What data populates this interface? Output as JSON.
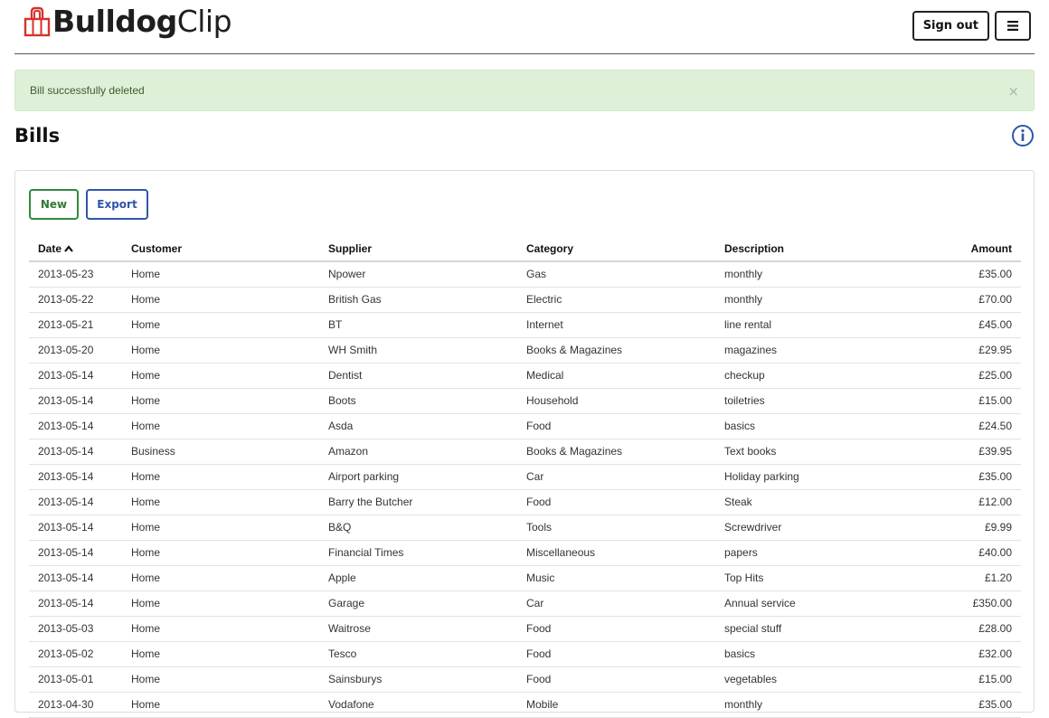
{
  "brand": {
    "bold": "Bulldog",
    "light": "Clip"
  },
  "header": {
    "sign_out_label": "Sign out"
  },
  "alert": {
    "message": "Bill successfully deleted",
    "close_label": "×"
  },
  "page": {
    "title": "Bills"
  },
  "toolbar": {
    "new_label": "New",
    "export_label": "Export"
  },
  "table": {
    "sort_column": "Date",
    "headers": {
      "date": "Date",
      "customer": "Customer",
      "supplier": "Supplier",
      "category": "Category",
      "description": "Description",
      "amount": "Amount"
    },
    "rows": [
      {
        "date": "2013-05-23",
        "customer": "Home",
        "supplier": "Npower",
        "category": "Gas",
        "description": "monthly",
        "amount": "£35.00"
      },
      {
        "date": "2013-05-22",
        "customer": "Home",
        "supplier": "British Gas",
        "category": "Electric",
        "description": "monthly",
        "amount": "£70.00"
      },
      {
        "date": "2013-05-21",
        "customer": "Home",
        "supplier": "BT",
        "category": "Internet",
        "description": "line rental",
        "amount": "£45.00"
      },
      {
        "date": "2013-05-20",
        "customer": "Home",
        "supplier": "WH Smith",
        "category": "Books & Magazines",
        "description": "magazines",
        "amount": "£29.95"
      },
      {
        "date": "2013-05-14",
        "customer": "Home",
        "supplier": "Dentist",
        "category": "Medical",
        "description": "checkup",
        "amount": "£25.00"
      },
      {
        "date": "2013-05-14",
        "customer": "Home",
        "supplier": "Boots",
        "category": "Household",
        "description": "toiletries",
        "amount": "£15.00"
      },
      {
        "date": "2013-05-14",
        "customer": "Home",
        "supplier": "Asda",
        "category": "Food",
        "description": "basics",
        "amount": "£24.50"
      },
      {
        "date": "2013-05-14",
        "customer": "Business",
        "supplier": "Amazon",
        "category": "Books & Magazines",
        "description": "Text books",
        "amount": "£39.95"
      },
      {
        "date": "2013-05-14",
        "customer": "Home",
        "supplier": "Airport parking",
        "category": "Car",
        "description": "Holiday parking",
        "amount": "£35.00"
      },
      {
        "date": "2013-05-14",
        "customer": "Home",
        "supplier": "Barry the Butcher",
        "category": "Food",
        "description": "Steak",
        "amount": "£12.00"
      },
      {
        "date": "2013-05-14",
        "customer": "Home",
        "supplier": "B&Q",
        "category": "Tools",
        "description": "Screwdriver",
        "amount": "£9.99"
      },
      {
        "date": "2013-05-14",
        "customer": "Home",
        "supplier": "Financial Times",
        "category": "Miscellaneous",
        "description": "papers",
        "amount": "£40.00"
      },
      {
        "date": "2013-05-14",
        "customer": "Home",
        "supplier": "Apple",
        "category": "Music",
        "description": "Top Hits",
        "amount": "£1.20"
      },
      {
        "date": "2013-05-14",
        "customer": "Home",
        "supplier": "Garage",
        "category": "Car",
        "description": "Annual service",
        "amount": "£350.00"
      },
      {
        "date": "2013-05-03",
        "customer": "Home",
        "supplier": "Waitrose",
        "category": "Food",
        "description": "special stuff",
        "amount": "£28.00"
      },
      {
        "date": "2013-05-02",
        "customer": "Home",
        "supplier": "Tesco",
        "category": "Food",
        "description": "basics",
        "amount": "£32.00"
      },
      {
        "date": "2013-05-01",
        "customer": "Home",
        "supplier": "Sainsburys",
        "category": "Food",
        "description": "vegetables",
        "amount": "£15.00"
      },
      {
        "date": "2013-04-30",
        "customer": "Home",
        "supplier": "Vodafone",
        "category": "Mobile",
        "description": "monthly",
        "amount": "£35.00"
      }
    ]
  },
  "colors": {
    "brand_red": "#d8312b",
    "new_green": "#2f8a3a",
    "export_blue": "#2f56a6",
    "alert_bg": "#dff0d8",
    "info_blue": "#2f56a6"
  },
  "icons": {
    "logo": "binder-clip-icon",
    "menu": "hamburger-menu-icon",
    "info": "info-circle-icon",
    "sort": "caret-up-icon",
    "close": "close-icon"
  }
}
